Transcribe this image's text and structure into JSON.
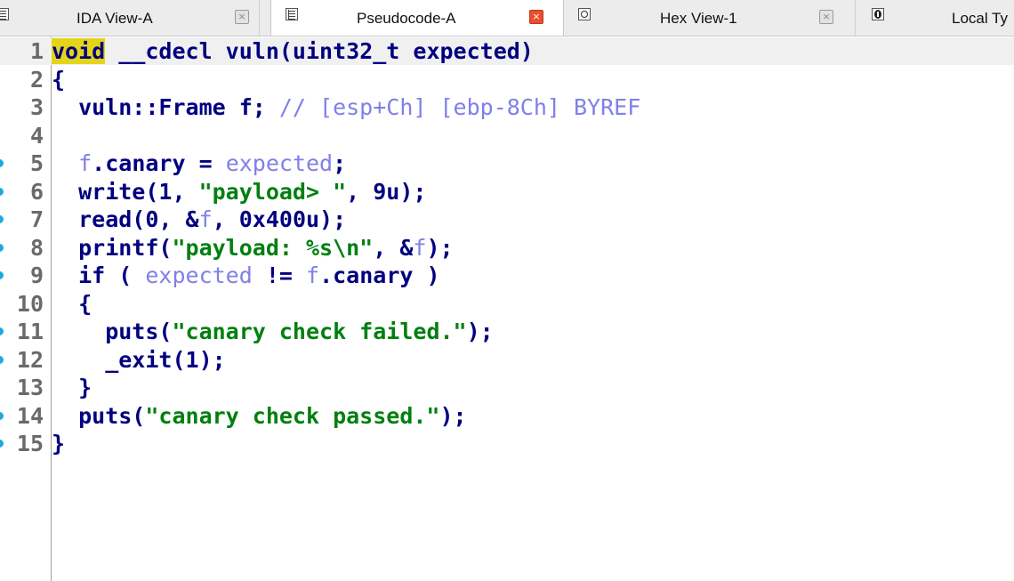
{
  "tabs": [
    {
      "label": "IDA View-A",
      "active": false
    },
    {
      "label": "Pseudocode-A",
      "active": true
    },
    {
      "label": "Hex View-1",
      "active": false
    },
    {
      "label": "Local Ty",
      "active": false
    }
  ],
  "tab_close_glyph": "×",
  "icons": {
    "tab_ida": "listing-icon",
    "tab_pseudocode": "listing-icon",
    "tab_hex": "hex-view-icon",
    "tab_local": "local-types-icon",
    "breakpoint": "breakpoint-dot-icon"
  },
  "colors": {
    "keyword": "#000080",
    "local_var": "#8080e6",
    "comment": "#7f7fea",
    "string": "#00800f",
    "cursor_highlight": "#e4d41a",
    "breakpoint": "#21a9df",
    "close_active": "#e8502e"
  },
  "code": {
    "lines": [
      {
        "n": "1",
        "bp": false,
        "tokens": [
          {
            "t": "void",
            "c": "cursor"
          },
          {
            "t": " __cdecl vuln(uint32_t expected)",
            "c": ""
          }
        ]
      },
      {
        "n": "2",
        "bp": false,
        "tokens": [
          {
            "t": "{",
            "c": ""
          }
        ]
      },
      {
        "n": "3",
        "bp": false,
        "tokens": [
          {
            "t": "  vuln::Frame f; ",
            "c": ""
          },
          {
            "t": "// [esp+Ch] [ebp-8Ch] BYREF",
            "c": "cmt"
          }
        ]
      },
      {
        "n": "4",
        "bp": false,
        "tokens": []
      },
      {
        "n": "5",
        "bp": true,
        "tokens": [
          {
            "t": "  ",
            "c": ""
          },
          {
            "t": "f",
            "c": "var"
          },
          {
            "t": ".canary = ",
            "c": ""
          },
          {
            "t": "expected",
            "c": "var"
          },
          {
            "t": ";",
            "c": ""
          }
        ]
      },
      {
        "n": "6",
        "bp": true,
        "tokens": [
          {
            "t": "  write(1, ",
            "c": ""
          },
          {
            "t": "\"payload> \"",
            "c": "str"
          },
          {
            "t": ", 9u);",
            "c": ""
          }
        ]
      },
      {
        "n": "7",
        "bp": true,
        "tokens": [
          {
            "t": "  read(0, &",
            "c": ""
          },
          {
            "t": "f",
            "c": "var"
          },
          {
            "t": ", 0x400u);",
            "c": ""
          }
        ]
      },
      {
        "n": "8",
        "bp": true,
        "tokens": [
          {
            "t": "  printf(",
            "c": ""
          },
          {
            "t": "\"payload: %s\\n\"",
            "c": "str"
          },
          {
            "t": ", &",
            "c": ""
          },
          {
            "t": "f",
            "c": "var"
          },
          {
            "t": ");",
            "c": ""
          }
        ]
      },
      {
        "n": "9",
        "bp": true,
        "tokens": [
          {
            "t": "  if ( ",
            "c": ""
          },
          {
            "t": "expected",
            "c": "var"
          },
          {
            "t": " != ",
            "c": ""
          },
          {
            "t": "f",
            "c": "var"
          },
          {
            "t": ".canary )",
            "c": ""
          }
        ]
      },
      {
        "n": "10",
        "bp": false,
        "tokens": [
          {
            "t": "  {",
            "c": ""
          }
        ]
      },
      {
        "n": "11",
        "bp": true,
        "tokens": [
          {
            "t": "    puts(",
            "c": ""
          },
          {
            "t": "\"canary check failed.\"",
            "c": "str"
          },
          {
            "t": ");",
            "c": ""
          }
        ]
      },
      {
        "n": "12",
        "bp": true,
        "tokens": [
          {
            "t": "    _exit(1);",
            "c": ""
          }
        ]
      },
      {
        "n": "13",
        "bp": false,
        "tokens": [
          {
            "t": "  }",
            "c": ""
          }
        ]
      },
      {
        "n": "14",
        "bp": true,
        "tokens": [
          {
            "t": "  puts(",
            "c": ""
          },
          {
            "t": "\"canary check passed.\"",
            "c": "str"
          },
          {
            "t": ");",
            "c": ""
          }
        ]
      },
      {
        "n": "15",
        "bp": true,
        "tokens": [
          {
            "t": "}",
            "c": ""
          }
        ]
      }
    ]
  }
}
